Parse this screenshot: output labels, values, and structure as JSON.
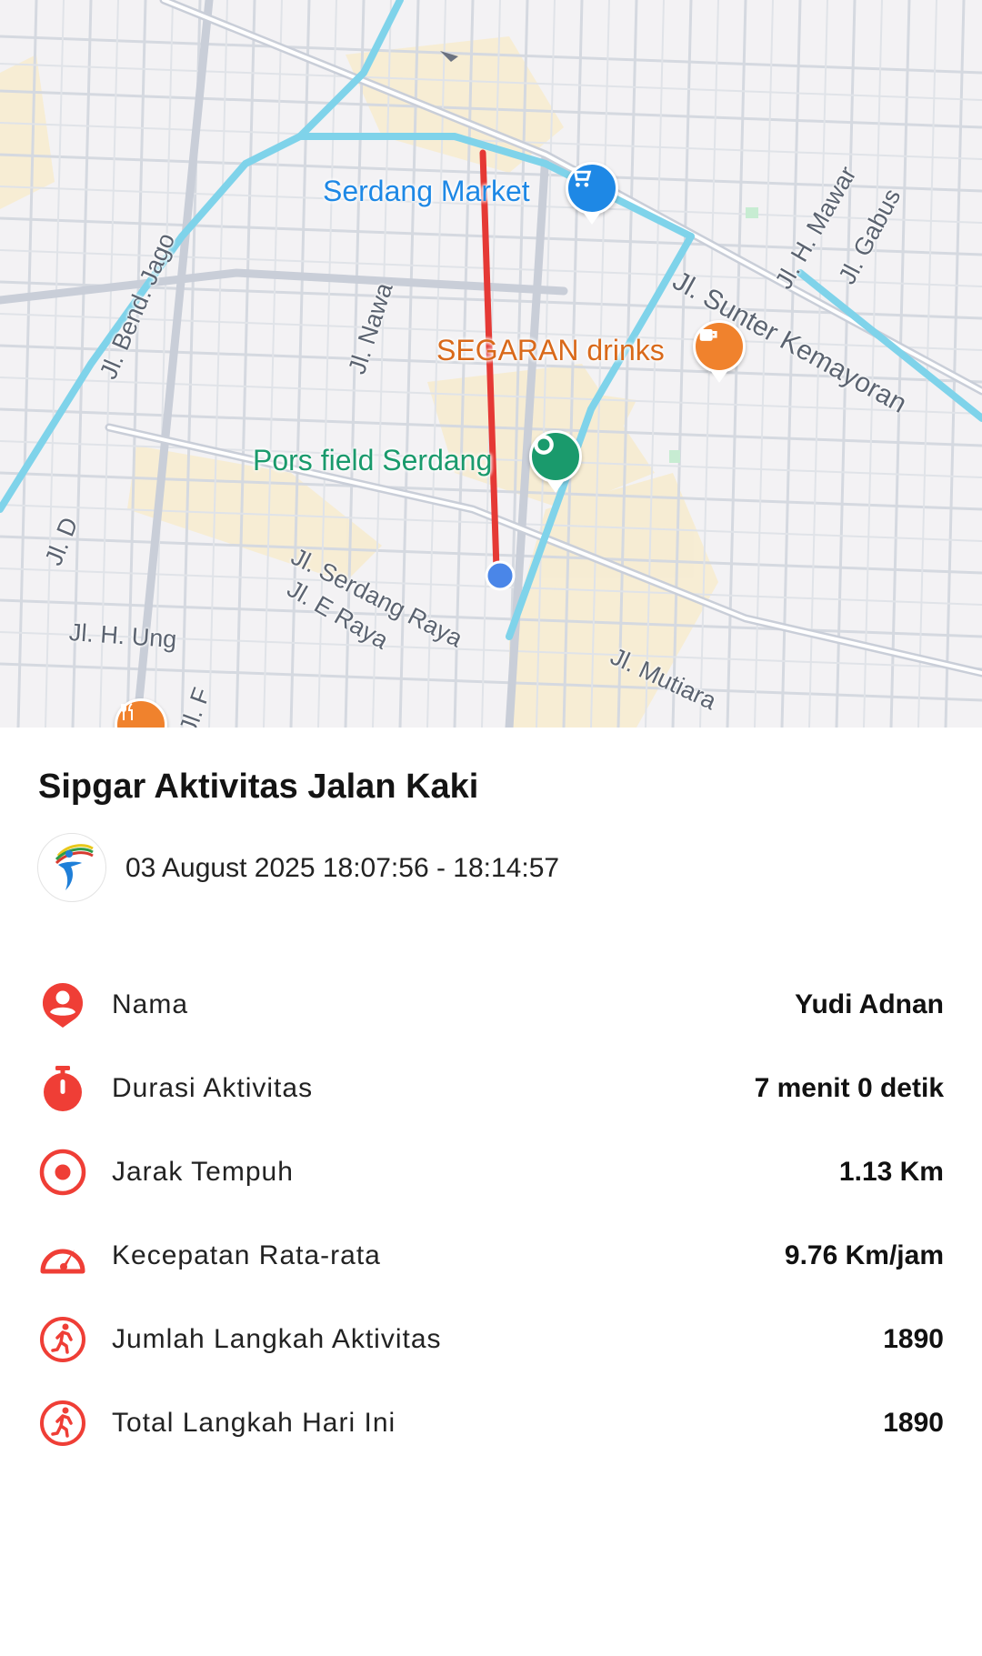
{
  "map": {
    "pois": {
      "market": "Serdang Market",
      "drinks": "SEGARAN drinks",
      "field": "Pors field Serdang"
    },
    "streets": {
      "bend_jago": "Jl. Bend. Jago",
      "nawa": "Jl. Nawa",
      "h_mawar": "Jl. H. Mawar",
      "gabus": "Jl. Gabus",
      "sunter": "Jl. Sunter Kemayoran",
      "d": "Jl. D",
      "serdang_raya": "Jl. Serdang Raya",
      "e_raya": "Jl. E Raya",
      "h_ung": "Jl. H. Ung",
      "f": "Jl. F",
      "mutiara": "Jl. Mutiara"
    },
    "colors": {
      "route": "#e53935",
      "current_position": "#4a86e8",
      "market_pin": "#1e88e5",
      "drinks_pin": "#f0822d",
      "field_pin": "#1a9a6c"
    }
  },
  "activity": {
    "title": "Sipgar Aktivitas Jalan Kaki",
    "datetime": "03 August 2025 18:07:56 - 18:14:57"
  },
  "stats": [
    {
      "icon": "person-pin-icon",
      "label": "Nama",
      "value": "Yudi Adnan"
    },
    {
      "icon": "stopwatch-icon",
      "label": "Durasi Aktivitas",
      "value": "7 menit 0 detik"
    },
    {
      "icon": "target-icon",
      "label": "Jarak Tempuh",
      "value": "1.13 Km"
    },
    {
      "icon": "speedometer-icon",
      "label": "Kecepatan Rata-rata",
      "value": "9.76 Km/jam"
    },
    {
      "icon": "walking-icon",
      "label": "Jumlah Langkah Aktivitas",
      "value": "1890"
    },
    {
      "icon": "walking-icon",
      "label": "Total Langkah Hari Ini",
      "value": "1890"
    }
  ],
  "accent_color": "#ef3e36"
}
